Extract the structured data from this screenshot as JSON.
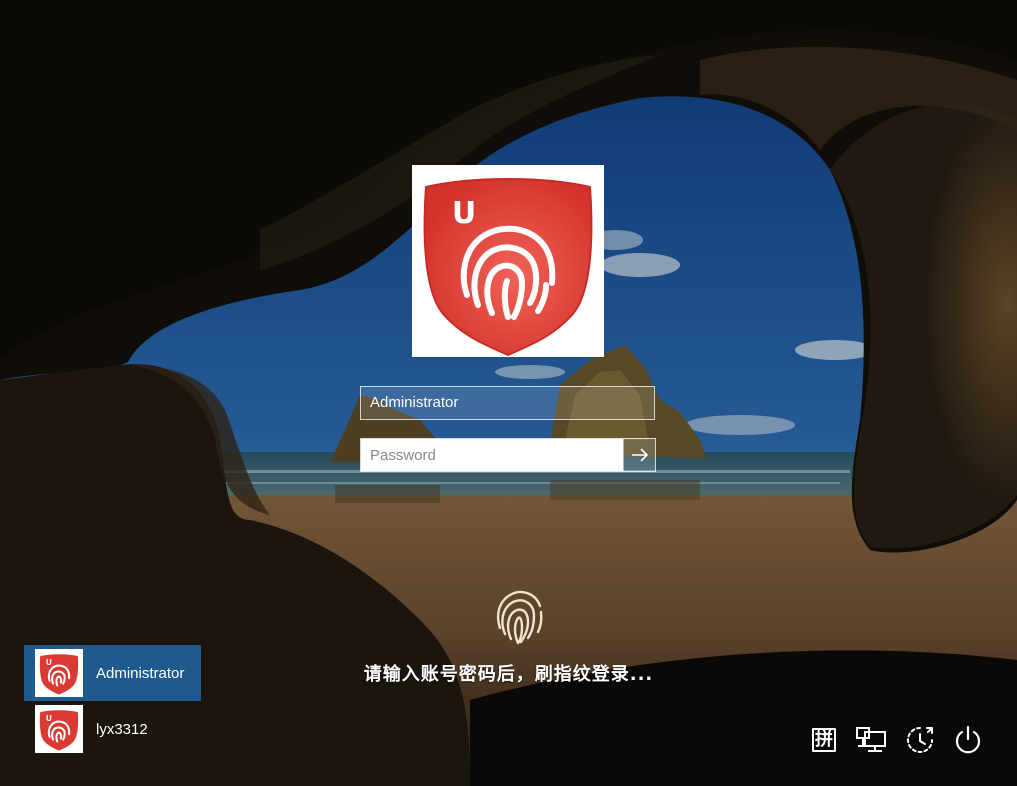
{
  "login": {
    "username": "Administrator",
    "password_placeholder": "Password",
    "hint": "请输入账号密码后，刷指纹登录..."
  },
  "users": [
    {
      "name": "Administrator",
      "selected": true
    },
    {
      "name": "lyx3312",
      "selected": false
    }
  ],
  "avatar": {
    "badge_letter": "U",
    "shield_color": "#d93a32"
  },
  "tray": {
    "ime_label": "拼",
    "icons": [
      "ime-icon",
      "network-icon",
      "ease-of-access-icon",
      "power-icon"
    ]
  },
  "colors": {
    "selected_user_bg": "#1f5a8f",
    "accent": "#1f5a8f"
  }
}
